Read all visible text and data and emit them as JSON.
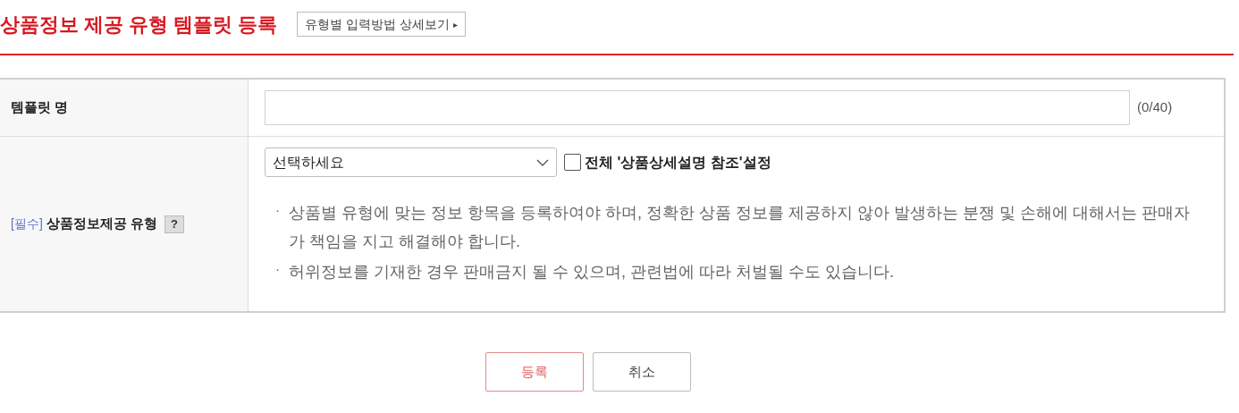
{
  "header": {
    "title": "상품정보 제공 유형 템플릿 등록",
    "guide_button": {
      "label": "유형별 입력방법 상세보기",
      "arrow": "▸"
    }
  },
  "form": {
    "rows": [
      {
        "kind": "text",
        "label": "템플릿 명",
        "field": {
          "counter": "(0/40)"
        }
      },
      {
        "kind": "select",
        "required_tag": "[필수]",
        "label": "상품정보제공 유형",
        "help": "?",
        "select": {
          "value": "선택하세요"
        },
        "checkbox": {
          "label": "전체 '상품상세설명 참조'설정",
          "checked": false
        },
        "notes": [
          {
            "bullet": "·",
            "text": "상품별 유형에 맞는 정보 항목을 등록하여야 하며, 정확한 상품 정보를 제공하지 않아 발생하는 분쟁 및 손해에 대해서는 판매자가 책임을 지고 해결해야 합니다."
          },
          {
            "bullet": "·",
            "text": "허위정보를 기재한 경우 판매금지 될 수 있으며, 관련법에 따라 처벌될 수도 있습니다."
          }
        ]
      }
    ]
  },
  "actions": [
    {
      "label": "등록",
      "kind": "primary"
    },
    {
      "label": "취소",
      "kind": "secondary"
    }
  ]
}
